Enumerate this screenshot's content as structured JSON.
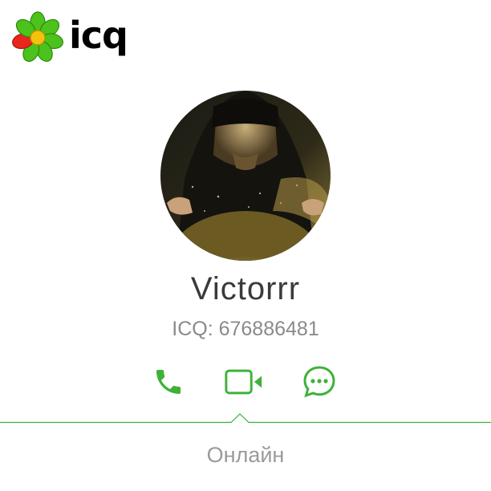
{
  "app": {
    "logo_text": "icq"
  },
  "profile": {
    "name": "Victorrr",
    "uin": "ICQ: 676886481"
  },
  "actions": {
    "call_icon": "phone-icon",
    "video_icon": "video-camera-icon",
    "chat_icon": "chat-bubble-icon"
  },
  "status": {
    "label": "Онлайн"
  },
  "colors": {
    "accent": "#3fb13a",
    "name_text": "#3a3a3a",
    "secondary_text": "#8a8a8a",
    "logo_petal_green": "#4cc21c",
    "logo_petal_red": "#e8261e",
    "logo_center": "#f4c20d"
  }
}
